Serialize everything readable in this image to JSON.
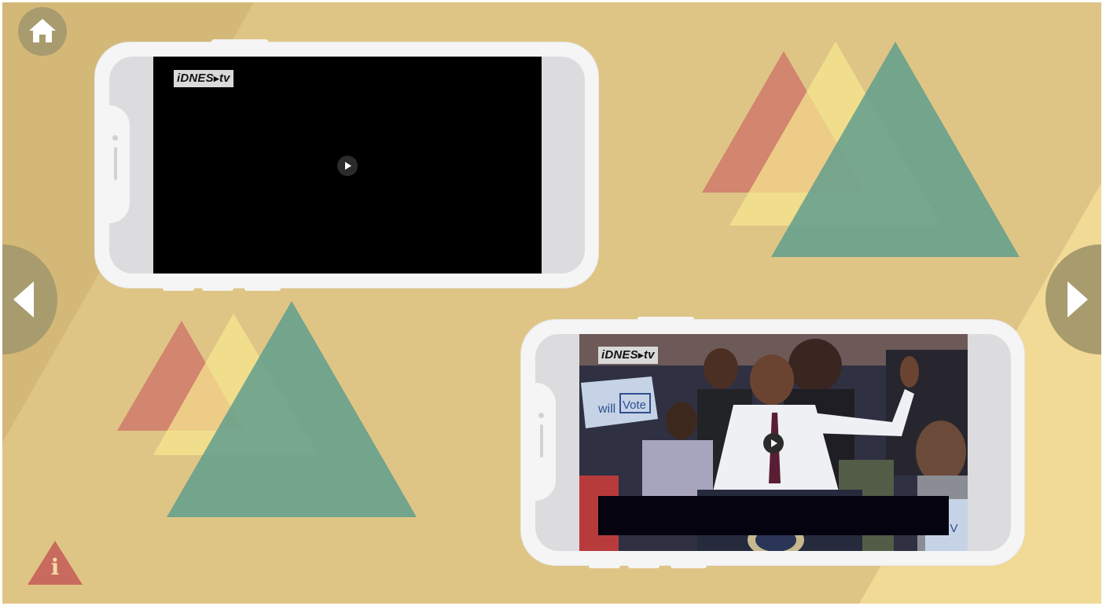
{
  "colors": {
    "background": "#dfc585",
    "background_dark": "#d2b776",
    "background_light": "#f0d893",
    "nav_circle": "#a89b6e",
    "triangle_red": "#d0766a",
    "triangle_yellow": "#f6e28a",
    "triangle_teal": "#5f9f8e",
    "phone_frame": "#f5f5f6"
  },
  "navigation": {
    "home_icon": "house-icon",
    "prev_icon": "arrow-left-icon",
    "next_icon": "arrow-right-icon",
    "info_icon": "info-triangle-icon",
    "info_text": "i"
  },
  "videos": [
    {
      "channel_logo": "iDNES",
      "channel_logo_suffix": "tv",
      "state": "loading",
      "play_icon": "play-icon"
    },
    {
      "channel_logo": "iDNES",
      "channel_logo_suffix": "tv",
      "state": "paused",
      "play_icon": "play-icon",
      "sign_text_1": "will",
      "sign_text_2": "Vote",
      "sign_text_3": "l V"
    }
  ]
}
